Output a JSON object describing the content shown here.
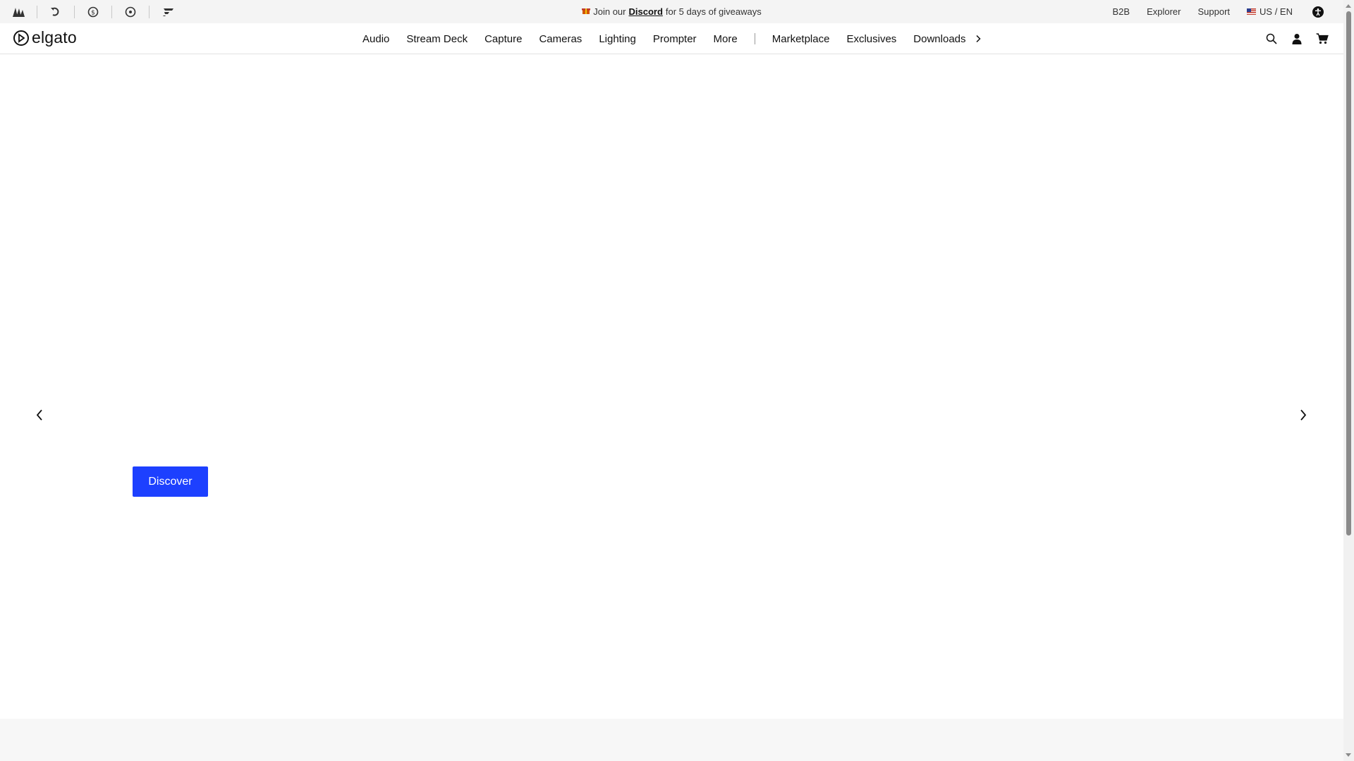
{
  "utility_bar": {
    "brand_icons": [
      "corsair-sails-icon",
      "refresh-brand-icon",
      "scuf-coin-icon",
      "origin-circle-icon",
      "drop-brand-icon"
    ],
    "promo": {
      "prefix": "Join our",
      "link": "Discord",
      "suffix": "for 5 days of giveaways",
      "icon": "gift-icon"
    },
    "links": [
      "B2B",
      "Explorer",
      "Support"
    ],
    "locale": "US / EN"
  },
  "nav": {
    "logo_text": "elgato",
    "items": [
      "Audio",
      "Stream Deck",
      "Capture",
      "Cameras",
      "Lighting",
      "Prompter",
      "More"
    ],
    "secondary_items": [
      "Marketplace",
      "Exclusives",
      "Downloads"
    ],
    "icons": [
      "search-icon",
      "account-icon",
      "cart-icon"
    ]
  },
  "hero": {
    "cta_label": "Discover"
  },
  "colors": {
    "accent": "#1d40ff",
    "utility_bg": "#f4f4f4",
    "lower_band": "#f7f7f7"
  }
}
